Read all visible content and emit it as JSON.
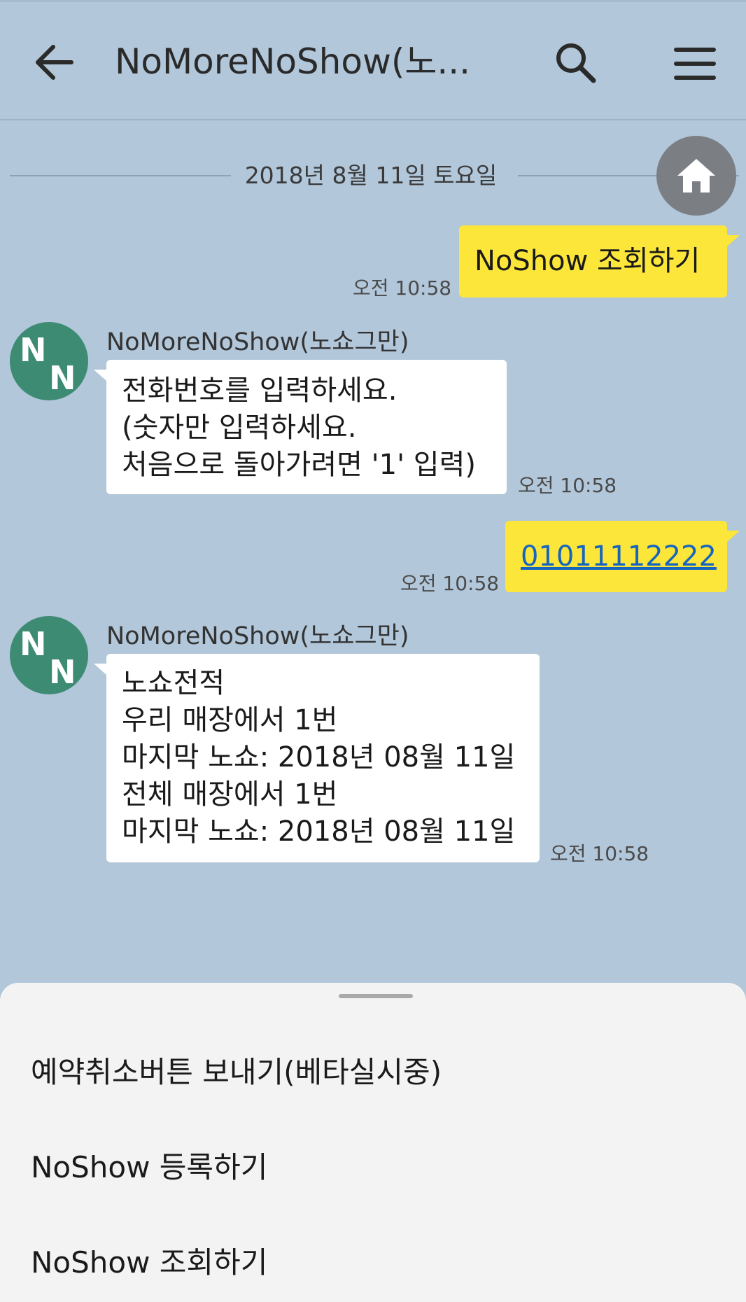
{
  "header": {
    "title": "NoMoreNoShow(노...",
    "icons": {
      "back": "arrow-left-icon",
      "search": "search-icon",
      "menu": "hamburger-menu-icon"
    }
  },
  "date_divider": "2018년 8월 11일 토요일",
  "home_button_icon": "home-icon",
  "messages": [
    {
      "from": "me",
      "text": "NoShow 조회하기",
      "time": "오전 10:58"
    },
    {
      "from": "bot",
      "sender": "NoMoreNoShow(노쇼그만)",
      "lines": [
        "전화번호를 입력하세요.",
        "(숫자만 입력하세요.",
        "처음으로 돌아가려면 '1' 입력)"
      ],
      "time": "오전 10:58"
    },
    {
      "from": "me",
      "text": "01011112222",
      "time": "오전 10:58"
    },
    {
      "from": "bot",
      "sender": "NoMoreNoShow(노쇼그만)",
      "lines": [
        "노쇼전적",
        "우리 매장에서 1번",
        "마지막 노쇼: 2018년 08월 11일",
        "전체 매장에서 1번",
        "마지막 노쇼: 2018년 08월 11일"
      ],
      "time": "오전 10:58"
    }
  ],
  "bottom_sheet": {
    "items": [
      "예약취소버튼 보내기(베타실시중)",
      "NoShow 등록하기",
      "NoShow 조회하기"
    ]
  },
  "colors": {
    "background": "#b2c7da",
    "my_bubble": "#fde63a",
    "bot_bubble": "#ffffff",
    "avatar": "#3e8b73",
    "link": "#1565c0"
  }
}
